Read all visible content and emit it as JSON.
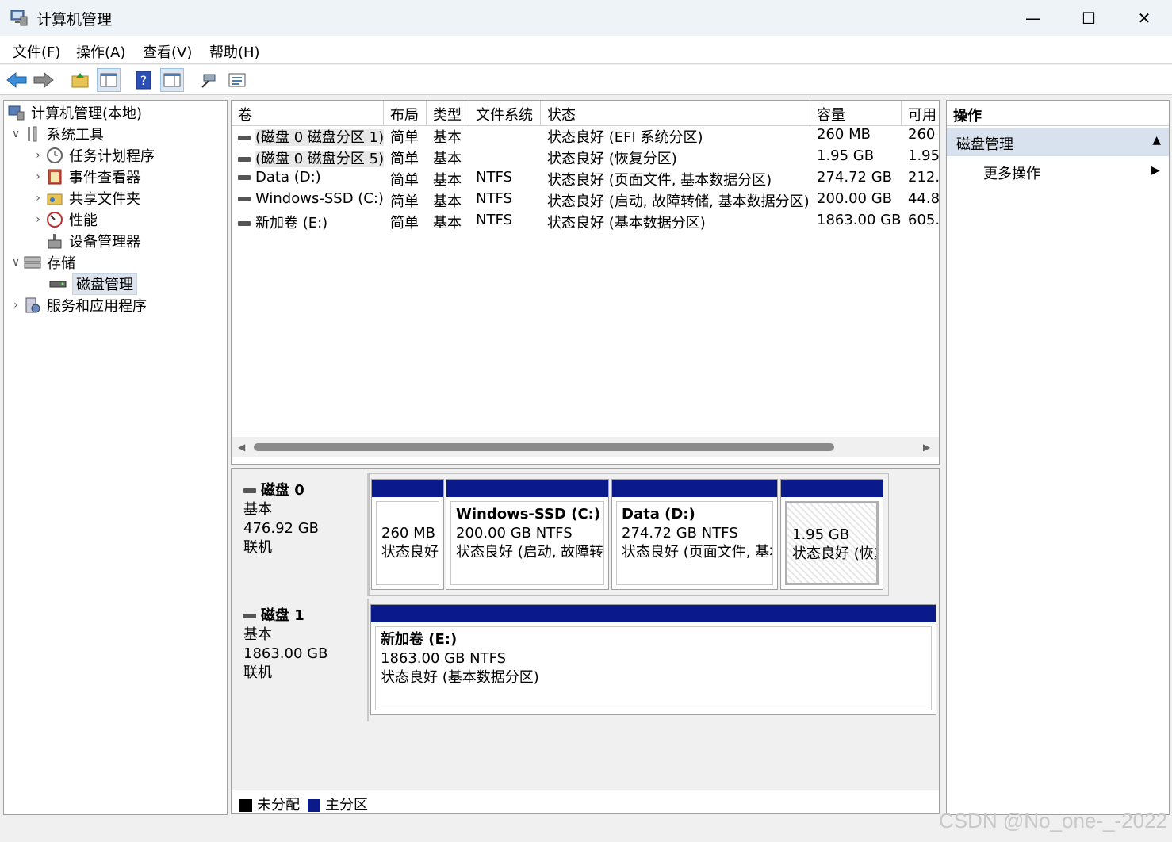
{
  "window": {
    "title": "计算机管理",
    "minimize": "—",
    "maximize": "☐",
    "close": "✕"
  },
  "menu": [
    "文件(F)",
    "操作(A)",
    "查看(V)",
    "帮助(H)"
  ],
  "tree": {
    "root": "计算机管理(本地)",
    "system_tools": "系统工具",
    "task_scheduler": "任务计划程序",
    "event_viewer": "事件查看器",
    "shared_folders": "共享文件夹",
    "performance": "性能",
    "device_manager": "设备管理器",
    "storage": "存储",
    "disk_management": "磁盘管理",
    "services_apps": "服务和应用程序"
  },
  "volumes": {
    "headers": [
      "卷",
      "布局",
      "类型",
      "文件系统",
      "状态",
      "容量",
      "可用"
    ],
    "rows": [
      [
        "(磁盘 0 磁盘分区 1)",
        "简单",
        "基本",
        "",
        "状态良好 (EFI 系统分区)",
        "260 MB",
        "260"
      ],
      [
        "(磁盘 0 磁盘分区 5)",
        "简单",
        "基本",
        "",
        "状态良好 (恢复分区)",
        "1.95 GB",
        "1.95"
      ],
      [
        "Data (D:)",
        "简单",
        "基本",
        "NTFS",
        "状态良好 (页面文件, 基本数据分区)",
        "274.72 GB",
        "212."
      ],
      [
        "Windows-SSD (C:)",
        "简单",
        "基本",
        "NTFS",
        "状态良好 (启动, 故障转储, 基本数据分区)",
        "200.00 GB",
        "44.8"
      ],
      [
        "新加卷 (E:)",
        "简单",
        "基本",
        "NTFS",
        "状态良好 (基本数据分区)",
        "1863.00 GB",
        "605."
      ]
    ]
  },
  "disks": {
    "disk0": {
      "name": "磁盘 0",
      "type": "基本",
      "size": "476.92 GB",
      "status": "联机",
      "parts": [
        {
          "title": "",
          "size": "260 MB",
          "status": "状态良好"
        },
        {
          "title": "Windows-SSD  (C:)",
          "size": "200.00 GB NTFS",
          "status": "状态良好 (启动, 故障转储"
        },
        {
          "title": "Data  (D:)",
          "size": "274.72 GB NTFS",
          "status": "状态良好 (页面文件, 基本"
        },
        {
          "title": "",
          "size": "1.95 GB",
          "status": "状态良好 (恢复"
        }
      ]
    },
    "disk1": {
      "name": "磁盘 1",
      "type": "基本",
      "size": "1863.00 GB",
      "status": "联机",
      "parts": [
        {
          "title": "新加卷  (E:)",
          "size": "1863.00 GB NTFS",
          "status": "状态良好 (基本数据分区)"
        }
      ]
    }
  },
  "legend": {
    "unallocated": "未分配",
    "primary": "主分区",
    "unallocated_color": "#000000",
    "primary_color": "#0a1a8a"
  },
  "actions": {
    "header": "操作",
    "section": "磁盘管理",
    "more": "更多操作"
  },
  "watermark": "CSDN @No_one-_-2022"
}
